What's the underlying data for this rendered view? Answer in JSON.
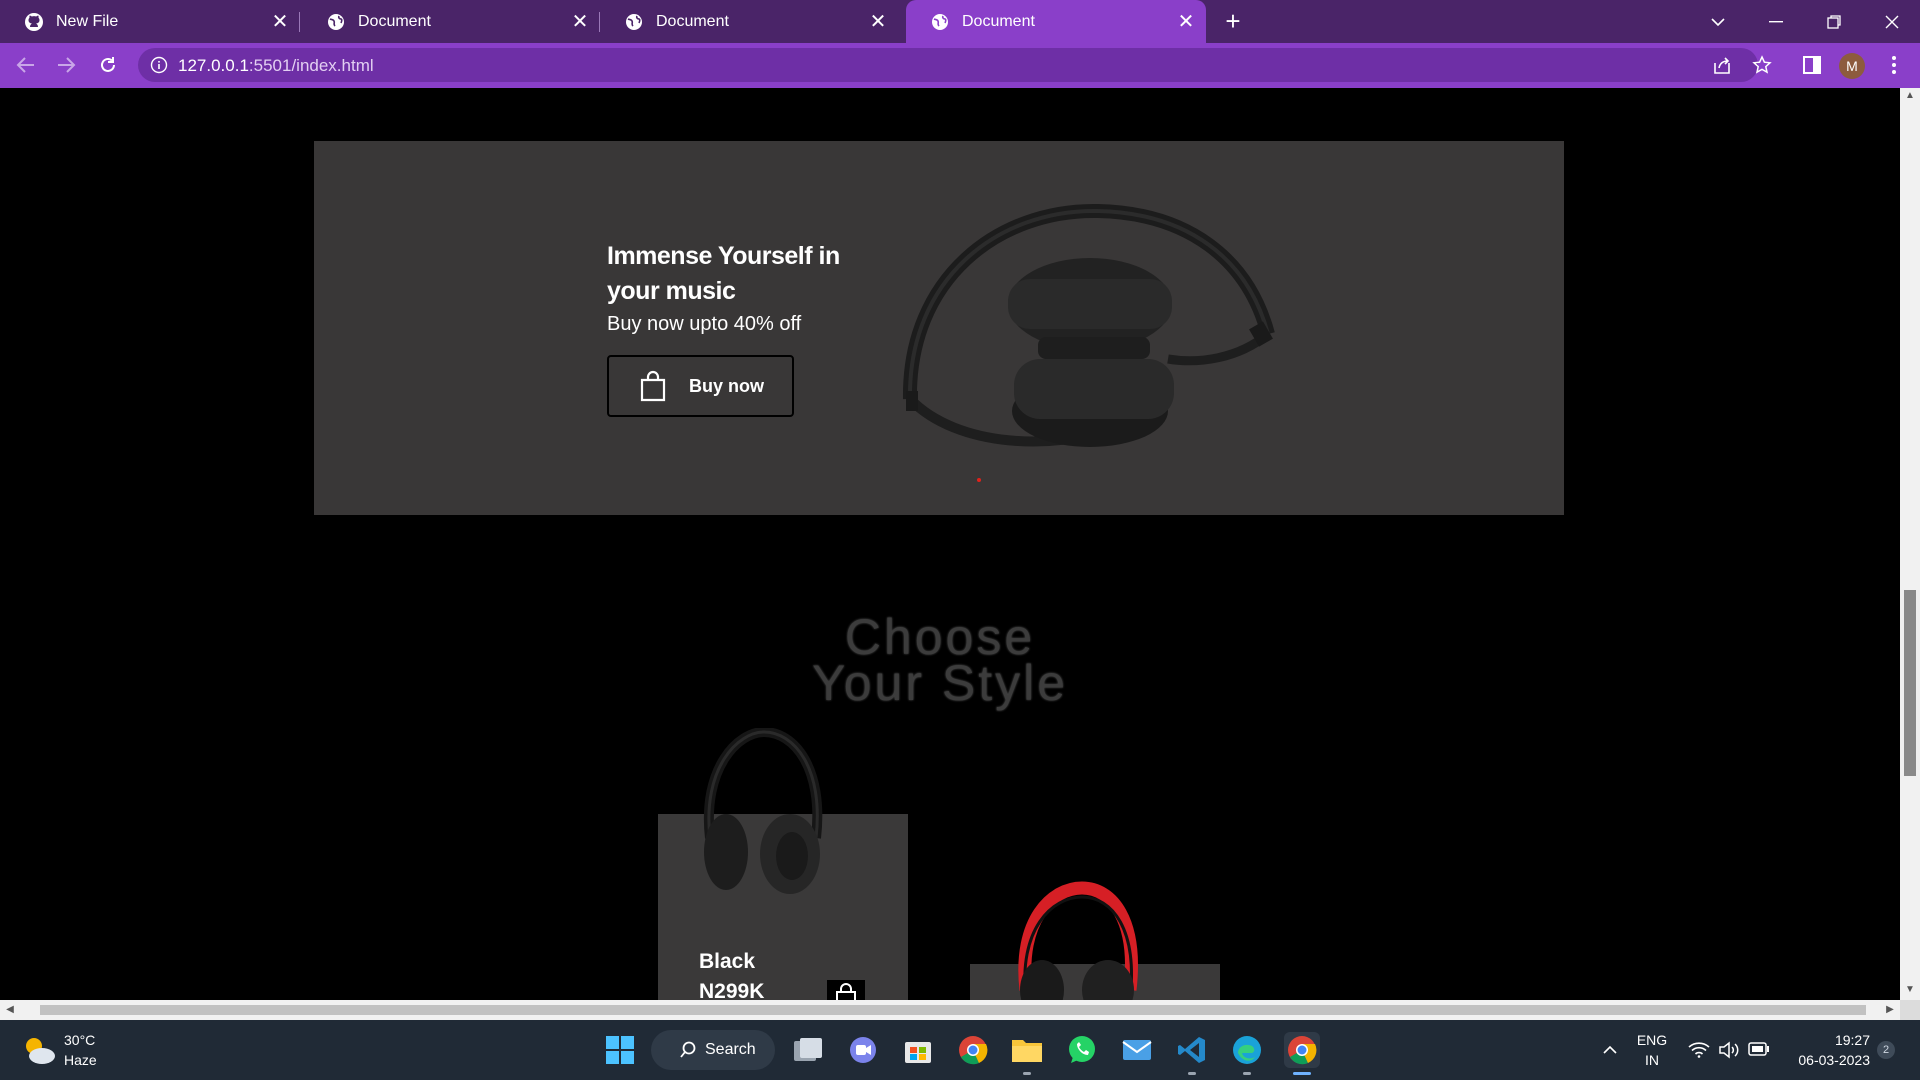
{
  "browser": {
    "tabs": [
      {
        "label": "New File",
        "icon": "github-icon",
        "active": false
      },
      {
        "label": "Document",
        "icon": "globe-icon",
        "active": false
      },
      {
        "label": "Document",
        "icon": "globe-icon",
        "active": false
      },
      {
        "label": "Document",
        "icon": "globe-icon",
        "active": true
      }
    ],
    "url_host": "127.0.0.1",
    "url_path": ":5501/index.html",
    "avatar_letter": "M",
    "accent_color": "#8a3fc9",
    "tabbar_color": "#4a2468"
  },
  "page": {
    "hero": {
      "title": "Immense Yourself in your music",
      "subtitle": "Buy now upto 40% off",
      "button_label": "Buy now",
      "background": "#393737"
    },
    "section_title": "Choose Your Style",
    "products": [
      {
        "name": "Black",
        "price": "N299K",
        "color": "black"
      },
      {
        "name": "",
        "price": "",
        "color": "red"
      }
    ]
  },
  "taskbar": {
    "weather_temp": "30°C",
    "weather_desc": "Haze",
    "search_label": "Search",
    "lang_top": "ENG",
    "lang_bottom": "IN",
    "time": "19:27",
    "date": "06-03-2023",
    "notification_count": "2"
  }
}
